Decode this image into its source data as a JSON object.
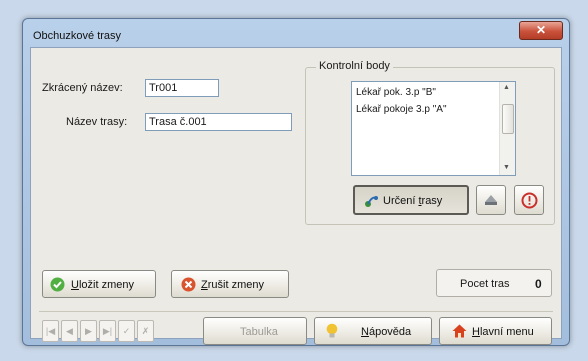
{
  "window": {
    "title": "Obchuzkové trasy",
    "close_symbol": "✕"
  },
  "form": {
    "short_name_label": "Zkrácený název:",
    "short_name_value": "Tr001",
    "route_name_label": "Název trasy:",
    "route_name_value": "Trasa č.001"
  },
  "checkpoints": {
    "group_title": "Kontrolní body",
    "items": [
      "Lékař pok. 3.p \"B\"",
      "Lékař pokoje 3.p \"A\""
    ],
    "define_route_button": {
      "label_pre": "Určení ",
      "label_ul": "t",
      "label_post": "rasy",
      "icon": "route-icon"
    },
    "print_icon": "printer-icon",
    "alert_icon": "alert-circle-icon"
  },
  "actions": {
    "save_ul": "U",
    "save_rest": "ložit zmeny",
    "cancel_ul": "Z",
    "cancel_rest": "rušit zmeny"
  },
  "count": {
    "label": "Pocet tras",
    "value": "0"
  },
  "footer": {
    "nav_buttons": [
      "|◀",
      "◀",
      "▶",
      "▶|",
      "✓",
      "✗"
    ],
    "table_button": "Tabulka",
    "help_ul": "N",
    "help_rest": "ápověda",
    "main_menu_ul": "H",
    "main_menu_rest": "lavní menu"
  },
  "colors": {
    "save_icon": "#52b043",
    "cancel_icon": "#d9532c",
    "help_icon": "#f1c232",
    "home_icon": "#d9411e"
  }
}
